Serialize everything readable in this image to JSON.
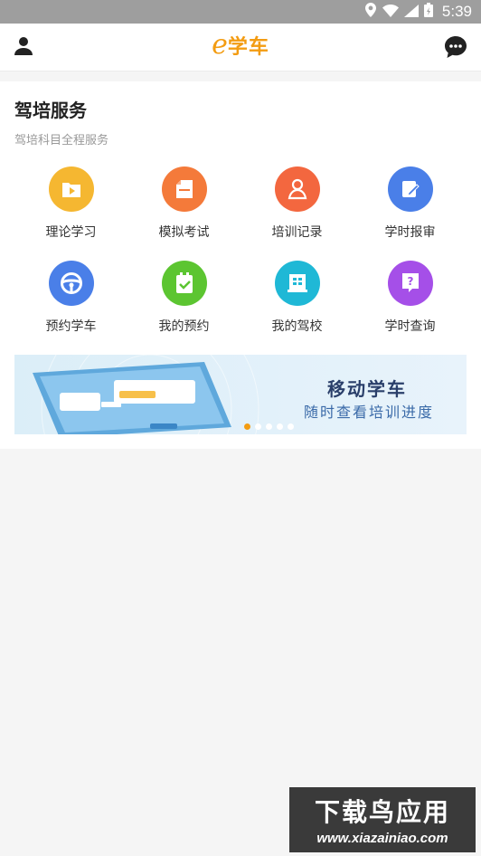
{
  "status_bar": {
    "time": "5:39",
    "icons": [
      "location-icon",
      "wifi-icon",
      "signal-icon",
      "battery-icon"
    ]
  },
  "header": {
    "logo_letter": "e",
    "logo_text": "学车",
    "left_icon": "user-icon",
    "right_icon": "chat-icon",
    "accent_color": "#f39c12"
  },
  "section": {
    "title": "驾培服务",
    "subtitle": "驾培科目全程服务"
  },
  "services": [
    {
      "label": "理论学习",
      "icon": "play-folder-icon",
      "color": "#f5b731"
    },
    {
      "label": "模拟考试",
      "icon": "document-icon",
      "color": "#f47a3a"
    },
    {
      "label": "培训记录",
      "icon": "driver-icon",
      "color": "#f3673f"
    },
    {
      "label": "学时报审",
      "icon": "edit-icon",
      "color": "#4a7fe8"
    },
    {
      "label": "预约学车",
      "icon": "steering-wheel-icon",
      "color": "#4a7fe8"
    },
    {
      "label": "我的预约",
      "icon": "clipboard-check-icon",
      "color": "#5cc531"
    },
    {
      "label": "我的驾校",
      "icon": "building-icon",
      "color": "#1fb8d6"
    },
    {
      "label": "学时查询",
      "icon": "question-icon",
      "color": "#a54fe8"
    }
  ],
  "banner": {
    "title": "移动学车",
    "subtitle": "随时查看培训进度",
    "slides": 5,
    "active_slide": 1
  },
  "watermark": {
    "line1": "下载鸟应用",
    "line2": "www.xiazainiao.com"
  }
}
